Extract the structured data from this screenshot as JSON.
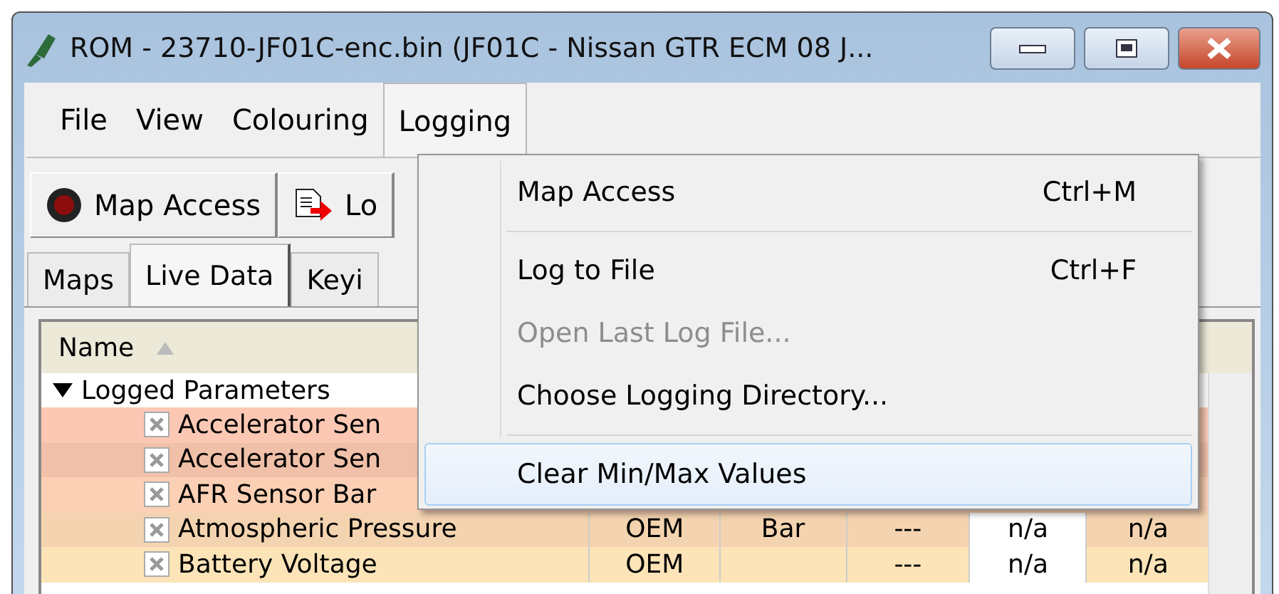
{
  "window": {
    "title": "ROM - 23710-JF01C-enc.bin (JF01C - Nissan GTR ECM 08 J..."
  },
  "menu_bar": [
    {
      "label": "File",
      "selected": false
    },
    {
      "label": "View",
      "selected": false
    },
    {
      "label": "Colouring",
      "selected": false
    },
    {
      "label": "Logging",
      "selected": true
    }
  ],
  "toolbar": [
    {
      "label": "Map Access",
      "kind": "record"
    },
    {
      "label": "Lo",
      "kind": "log"
    }
  ],
  "tabs": [
    {
      "label": "Maps",
      "selected": false
    },
    {
      "label": "Live Data",
      "selected": true
    },
    {
      "label": "Keyi",
      "selected": false
    }
  ],
  "table": {
    "columns": [
      "Name"
    ],
    "group": {
      "label": "Logged Parameters",
      "expanded": true
    },
    "rows": [
      {
        "name": "Accelerator Sen",
        "checked": true,
        "color": "#fcc8b4",
        "cells": []
      },
      {
        "name": "Accelerator Sen",
        "checked": true,
        "color": "#f0c0a8",
        "cells": []
      },
      {
        "name": "AFR Sensor Bar",
        "checked": true,
        "color": "#fcd0b4",
        "cells": []
      },
      {
        "name": "Atmospheric Pressure",
        "checked": true,
        "color": "#f4d4b0",
        "cells": [
          "OEM",
          "Bar",
          "---",
          "n/a",
          "n/a"
        ]
      },
      {
        "name": "Battery Voltage",
        "checked": true,
        "color": "#fce4b8",
        "cells": [
          "OEM",
          "",
          "---",
          "n/a",
          "n/a"
        ]
      }
    ]
  },
  "logging_menu": [
    {
      "label": "Map Access",
      "shortcut": "Ctrl+M",
      "kind": "item",
      "disabled": false,
      "selected": false
    },
    {
      "kind": "separator"
    },
    {
      "label": "Log to File",
      "shortcut": "Ctrl+F",
      "kind": "item",
      "disabled": false,
      "selected": false
    },
    {
      "label": "Open Last Log File...",
      "kind": "item",
      "disabled": true,
      "selected": false
    },
    {
      "label": "Choose Logging Directory...",
      "kind": "item",
      "disabled": false,
      "selected": false
    },
    {
      "kind": "separator"
    },
    {
      "label": "Clear Min/Max Values",
      "kind": "item",
      "disabled": false,
      "selected": true
    }
  ]
}
